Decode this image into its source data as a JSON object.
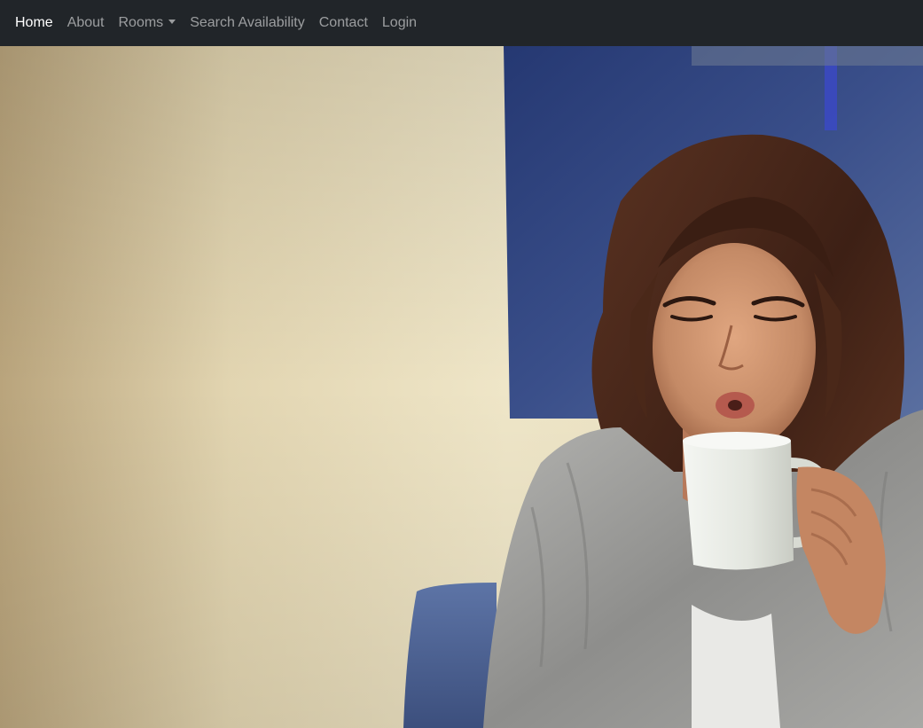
{
  "navbar": {
    "items": [
      {
        "label": "Home",
        "active": true
      },
      {
        "label": "About",
        "active": false
      },
      {
        "label": "Rooms",
        "active": false,
        "dropdown": true
      },
      {
        "label": "Search Availability",
        "active": false
      },
      {
        "label": "Contact",
        "active": false
      },
      {
        "label": "Login",
        "active": false
      }
    ]
  },
  "hero": {
    "image_subject": "woman blowing on a white coffee mug",
    "colors": {
      "navbar_bg": "#212529",
      "wall": "#e6dcba",
      "panel_blue": "#2c3f7a",
      "hair": "#4a2a1c",
      "skin": "#c98d6b",
      "sweater": "#9c9c9a",
      "mug": "#e8ebe6"
    }
  }
}
